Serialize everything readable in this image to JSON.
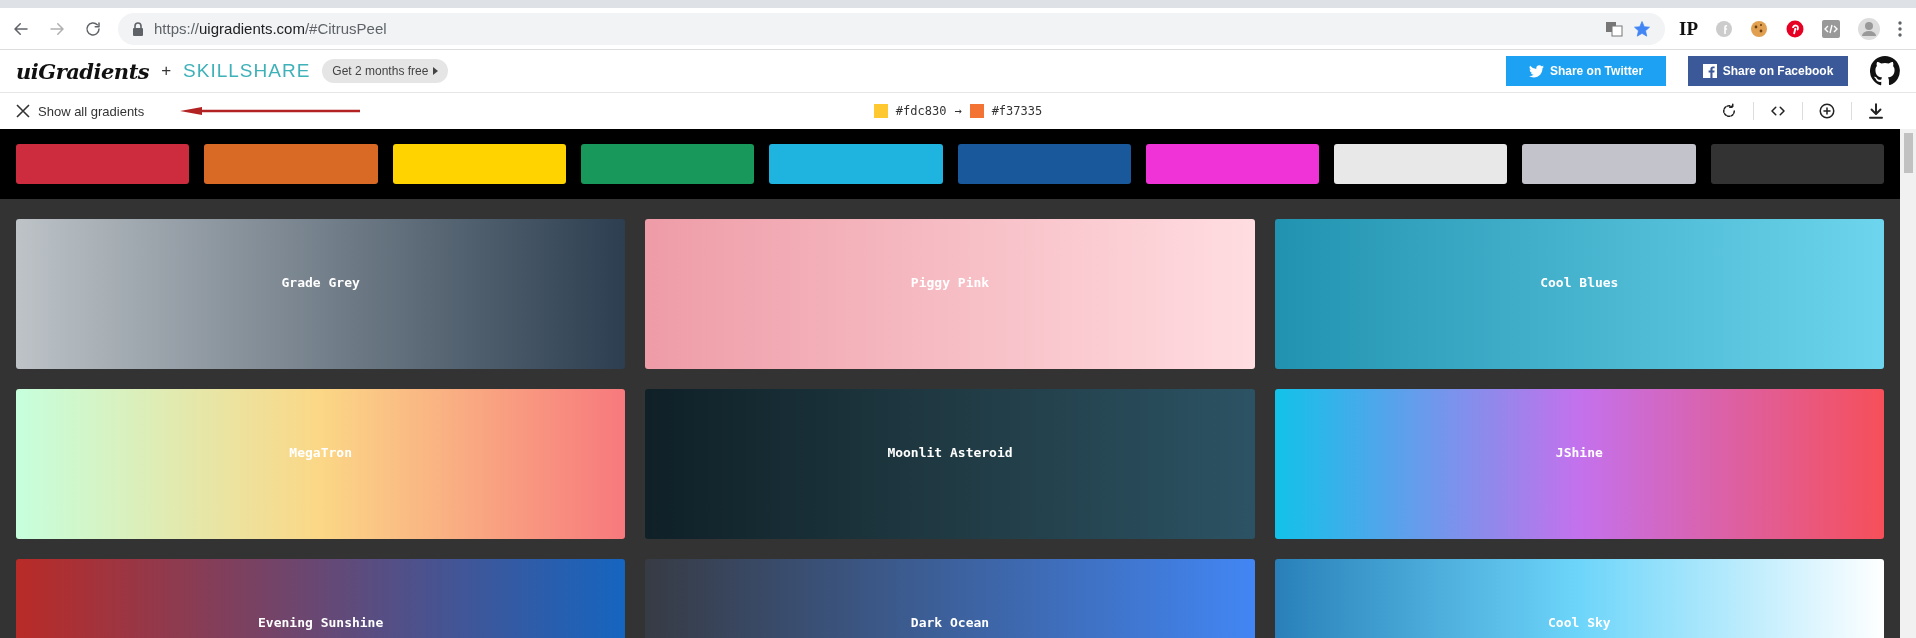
{
  "browser": {
    "url": {
      "scheme": "https://",
      "host": "uigradients.com",
      "path": "/#CitrusPeel"
    },
    "forward_disabled": true,
    "bookmarked": true,
    "extension_label": "IP"
  },
  "header": {
    "logo": "uiGradients",
    "plus": "+",
    "partner": "SKILLSHARE",
    "promo": "Get 2 months free",
    "share_buttons": [
      {
        "kind": "twitter",
        "label": "Share on Twitter"
      },
      {
        "kind": "facebook",
        "label": "Share on Facebook"
      }
    ]
  },
  "toolbar": {
    "show_all": "Show all gradients",
    "from": {
      "label": "#fdc830",
      "color": "#fdc830"
    },
    "arrow": "→",
    "to": {
      "label": "#f37335",
      "color": "#f37335"
    }
  },
  "swatches": [
    {
      "color": "#cd2c3e"
    },
    {
      "color": "#d96a26"
    },
    {
      "color": "#ffd300"
    },
    {
      "color": "#18985a"
    },
    {
      "color": "#1fb3e0"
    },
    {
      "color": "#19599b"
    },
    {
      "color": "#f033d6"
    },
    {
      "color": "#e8e8e8"
    },
    {
      "color": "#c3c3cb"
    },
    {
      "color": "#333333"
    }
  ],
  "gradients": [
    {
      "name": "Grade Grey",
      "color": "#bdc3c7"
    },
    {
      "name": "Piggy Pink",
      "color": "#ee9ca7"
    },
    {
      "name": "Cool Blues",
      "color": "#2193b0"
    },
    {
      "name": "MegaTron",
      "color": "#c6ffdd"
    },
    {
      "name": "Moonlit Asteroid",
      "color": "#0f2027"
    },
    {
      "name": "JShine",
      "color": "#12c2e9"
    },
    {
      "name": "Evening Sunshine",
      "color": "#b92b27"
    },
    {
      "name": "Dark Ocean",
      "color": "#373b44"
    },
    {
      "name": "Cool Sky",
      "color": "#2980b9"
    }
  ]
}
